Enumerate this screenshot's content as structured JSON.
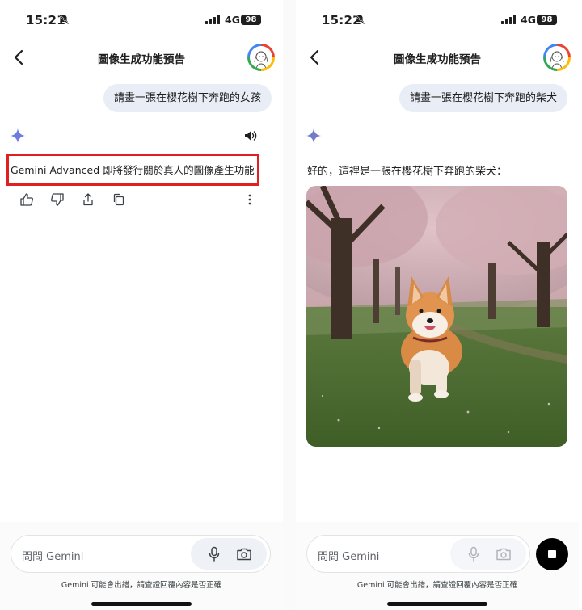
{
  "screens": [
    {
      "status": {
        "time": "15:21",
        "network": "4G",
        "battery": "98"
      },
      "header": {
        "title": "圖像生成功能預告"
      },
      "user_message": "請畫一張在櫻花樹下奔跑的女孩",
      "response": {
        "text": "Gemini Advanced 即將發行關於真人的圖像產生功能",
        "highlight_color": "#e02020"
      },
      "input": {
        "placeholder": "問問 Gemini"
      },
      "disclaimer": "Gemini 可能會出錯，請查證回覆內容是否正確"
    },
    {
      "status": {
        "time": "15:22",
        "network": "4G",
        "battery": "98"
      },
      "header": {
        "title": "圖像生成功能預告"
      },
      "user_message": "請畫一張在櫻花樹下奔跑的柴犬",
      "response": {
        "text": "好的，這裡是一張在櫻花樹下奔跑的柴犬："
      },
      "input": {
        "placeholder": "問問 Gemini"
      },
      "disclaimer": "Gemini 可能會出錯，請查證回覆內容是否正確"
    }
  ],
  "icons": [
    "muted-bell-icon",
    "signal-icon",
    "back-arrow-icon",
    "gemini-spark-icon",
    "speaker-icon",
    "thumbs-up-icon",
    "thumbs-down-icon",
    "share-icon",
    "copy-icon",
    "more-icon",
    "microphone-icon",
    "camera-icon",
    "stop-icon"
  ],
  "colors": {
    "accent": "#4285f4",
    "bubble": "#e9eef6",
    "highlight": "#e02020"
  }
}
